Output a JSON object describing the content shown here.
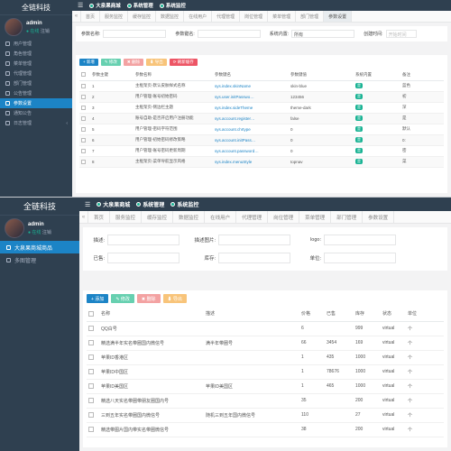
{
  "screen1": {
    "logo": "全链科技",
    "user": {
      "name": "admin",
      "status": "● 在线",
      "logout": "注销"
    },
    "menu": [
      {
        "label": "用户管理",
        "icon": "user-icon"
      },
      {
        "label": "角色管理",
        "icon": "role-icon"
      },
      {
        "label": "菜单管理",
        "icon": "menu-icon"
      },
      {
        "label": "代理管理",
        "icon": "agent-icon"
      },
      {
        "label": "部门管理",
        "icon": "dept-icon"
      },
      {
        "label": "公告管理",
        "icon": "notice-icon"
      },
      {
        "label": "参数设置",
        "icon": "settings-icon",
        "active": true
      },
      {
        "label": "通知公告",
        "icon": "bell-icon"
      },
      {
        "label": "日志管理",
        "icon": "log-icon",
        "arrow": "‹"
      }
    ],
    "topbar": {
      "items": [
        "大泉果商城",
        "系统管理",
        "系统监控"
      ]
    },
    "tabs": [
      "首页",
      "服务监控",
      "缓存监控",
      "数据监控",
      "在线用户",
      "代理管理",
      "岗位管理",
      "菜单管理",
      "部门管理",
      "参数设置"
    ],
    "active_tab": 9,
    "search": {
      "name_label": "参数名称:",
      "key_label": "参数键名:",
      "type_label": "系统内置:",
      "type_value": "所有",
      "time_label": "创建时间:",
      "time_placeholder": "开始时间"
    },
    "toolbar": {
      "add": "+ 新增",
      "edit": "✎ 修改",
      "del": "✖ 删除",
      "export": "⬇ 导出",
      "refresh": "⟳ 刷新缓存"
    },
    "columns": [
      "参数主键",
      "参数名称",
      "参数键名",
      "参数键值",
      "系统内置",
      "备注"
    ],
    "rows": [
      [
        "1",
        "主框架页-默认皮肤样式名称",
        "sys.index.skinName",
        "skin-blue",
        "是",
        "蓝色"
      ],
      [
        "2",
        "用户管理-账号初始密码",
        "sys.user.initPasswo…",
        "123456",
        "是",
        "初"
      ],
      [
        "3",
        "主框架页-侧边栏主题",
        "sys.index.sideTheme",
        "theme-dark",
        "是",
        "深"
      ],
      [
        "4",
        "账号自助-是否开启用户注册功能",
        "sys.account.register…",
        "false",
        "是",
        "是"
      ],
      [
        "5",
        "用户管理-密码字符范围",
        "sys.account.chrtype",
        "0",
        "是",
        "默认"
      ],
      [
        "6",
        "用户管理-初始密码修改策略",
        "sys.account.initPass…",
        "0",
        "是",
        "0:"
      ],
      [
        "7",
        "用户管理-账号密码更新周期",
        "sys.account.password…",
        "0",
        "是",
        "密"
      ],
      [
        "8",
        "主框架页-菜单导航显示风格",
        "sys.index.menuStyle",
        "topnav",
        "是",
        "菜"
      ]
    ]
  },
  "screen2": {
    "logo": "全链科技",
    "user": {
      "name": "admin",
      "status": "● 在线",
      "logout": "注销"
    },
    "menu": [
      {
        "label": "大泉果商城商品",
        "icon": "goods-icon",
        "active": true
      },
      {
        "label": "多图管理",
        "icon": "images-icon"
      }
    ],
    "topbar": {
      "items": [
        "大泉果商城",
        "系统管理",
        "系统监控"
      ]
    },
    "tabs": [
      "首页",
      "服务监控",
      "缓存监控",
      "数据监控",
      "在线用户",
      "代理管理",
      "岗位管理",
      "菜单管理",
      "部门管理",
      "参数设置"
    ],
    "search": {
      "desc_label": "描述:",
      "image_label": "描述图片:",
      "logo_label": "logo:",
      "sold_label": "已售:",
      "stock_label": "库存:",
      "unit_label": "单位:"
    },
    "toolbar": {
      "add": "+ 添加",
      "edit": "✎ 修改",
      "del": "✖ 删除",
      "export": "⬇ 导出"
    },
    "columns": [
      "名称",
      "描述",
      "价格",
      "已售",
      "库存",
      "状态",
      "单位"
    ],
    "rows": [
      [
        "QQ白号",
        "",
        "6",
        "",
        "999",
        "virtual",
        "个"
      ],
      [
        "精选满半年实名带圈国内微信号",
        "满半年带圈号",
        "66",
        "3454",
        "169",
        "virtual",
        "个"
      ],
      [
        "苹果ID香港区",
        "",
        "1",
        "435",
        "1000",
        "virtual",
        "个"
      ],
      [
        "苹果ID中国区",
        "",
        "1",
        "78676",
        "1000",
        "virtual",
        "个"
      ],
      [
        "苹果ID美国区",
        "苹果ID美国区",
        "1",
        "465",
        "1000",
        "virtual",
        "个"
      ],
      [
        "精选八天实名带圈带朋友圈国内号",
        "",
        "35",
        "",
        "200",
        "virtual",
        "个"
      ],
      [
        "三到五年实名带圈国内微信号",
        "随机三到五年国内微信号",
        "110",
        "",
        "27",
        "virtual",
        "个"
      ],
      [
        "精选带图片国内带实名带圈微信号",
        "",
        "38",
        "",
        "200",
        "virtual",
        "个"
      ]
    ]
  }
}
